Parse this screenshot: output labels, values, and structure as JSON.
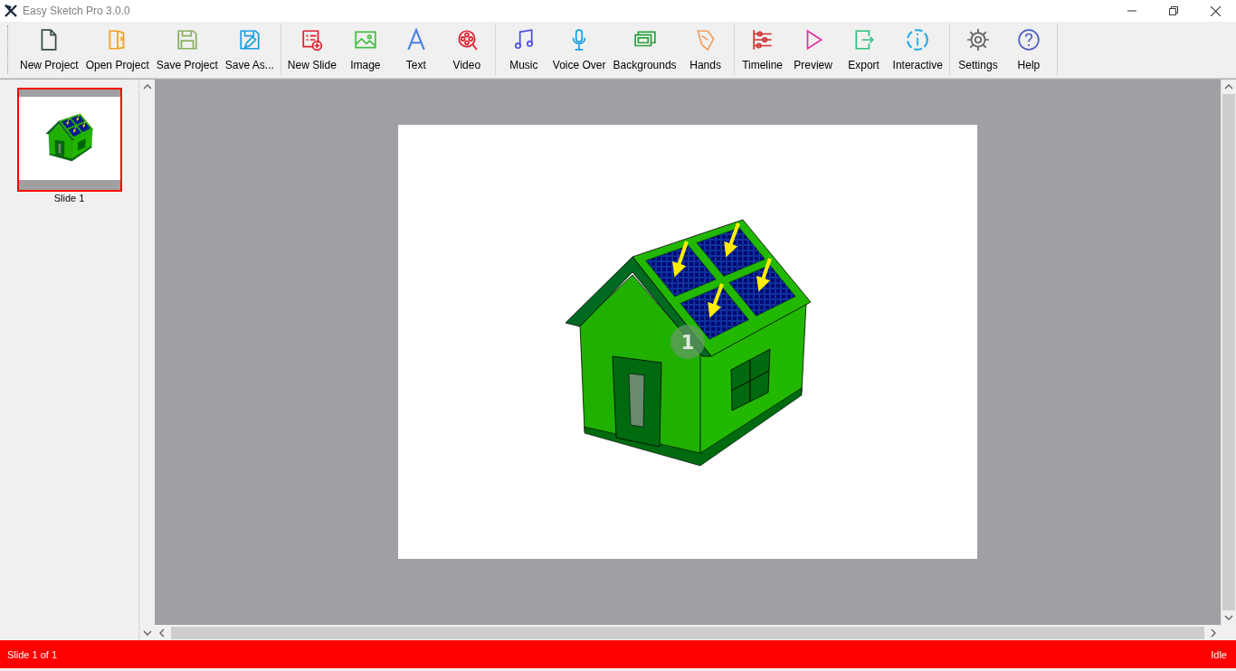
{
  "window": {
    "title": "Easy Sketch Pro 3.0.0"
  },
  "toolbar": {
    "groups": [
      [
        {
          "label": "New Project"
        },
        {
          "label": "Open Project"
        },
        {
          "label": "Save Project"
        },
        {
          "label": "Save As..."
        }
      ],
      [
        {
          "label": "New Slide"
        },
        {
          "label": "Image"
        },
        {
          "label": "Text"
        },
        {
          "label": "Video"
        }
      ],
      [
        {
          "label": "Music"
        },
        {
          "label": "Voice Over"
        },
        {
          "label": "Backgrounds"
        },
        {
          "label": "Hands"
        }
      ],
      [
        {
          "label": "Timeline"
        },
        {
          "label": "Preview"
        },
        {
          "label": "Export"
        },
        {
          "label": "Interactive"
        }
      ],
      [
        {
          "label": "Settings"
        },
        {
          "label": "Help"
        }
      ]
    ]
  },
  "slides": [
    {
      "label": "Slide 1",
      "selected": true
    }
  ],
  "canvas": {
    "badge": "1"
  },
  "status_bar": {
    "left": "Slide 1 of 1",
    "right": "Idle"
  }
}
